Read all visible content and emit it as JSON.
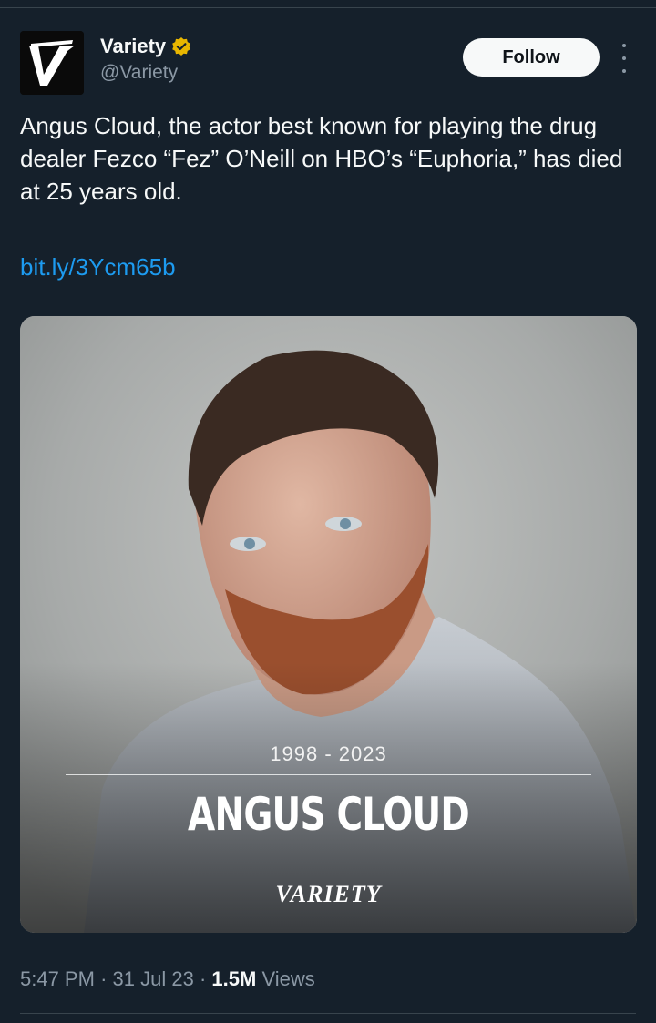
{
  "author": {
    "display_name": "Variety",
    "handle": "@Variety",
    "avatar_letter": "V",
    "verified_color": "#e8b600"
  },
  "actions": {
    "follow_label": "Follow"
  },
  "tweet": {
    "text": "Angus Cloud, the actor best known for playing the drug dealer Fezco “Fez” O’Neill on HBO’s “Euphoria,” has died at 25 years old.",
    "link": "bit.ly/3Ycm65b"
  },
  "media": {
    "years": "1998 - 2023",
    "name": "ANGUS CLOUD",
    "brand": "VARIETY"
  },
  "meta": {
    "time": "5:47 PM",
    "date": "31 Jul 23",
    "views_count": "1.5M",
    "views_label": "Views",
    "separator": "·"
  },
  "colors": {
    "background": "#15202b",
    "link": "#1d9bf0",
    "secondary_text": "#8b98a5"
  }
}
